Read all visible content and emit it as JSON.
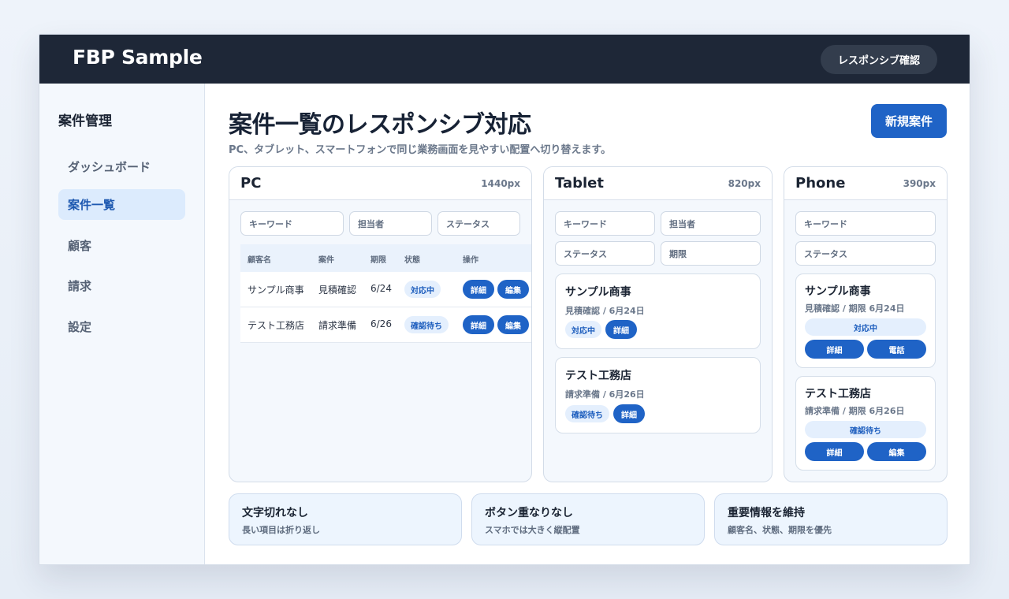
{
  "app": {
    "brand": "FBP Sample",
    "responsive_check_label": "レスポンシブ確認"
  },
  "sidebar": {
    "title": "案件管理",
    "items": [
      {
        "label": "ダッシュボード",
        "active": false
      },
      {
        "label": "案件一覧",
        "active": true
      },
      {
        "label": "顧客",
        "active": false
      },
      {
        "label": "請求",
        "active": false
      },
      {
        "label": "設定",
        "active": false
      }
    ]
  },
  "main": {
    "title": "案件一覧のレスポンシブ対応",
    "subtitle": "PC、タブレット、スマートフォンで同じ業務画面を見やすい配置へ切り替えます。",
    "new_button": "新規案件"
  },
  "pc": {
    "name": "PC",
    "width_label": "1440px",
    "filters": [
      "キーワード",
      "担当者",
      "ステータス"
    ],
    "columns": [
      "顧客名",
      "案件",
      "期限",
      "状態",
      "操作"
    ],
    "rows": [
      {
        "customer": "サンプル商事",
        "project": "見積確認",
        "due": "6/24",
        "status": "対応中",
        "actions": [
          "詳細",
          "編集"
        ]
      },
      {
        "customer": "テスト工務店",
        "project": "請求準備",
        "due": "6/26",
        "status": "確認待ち",
        "actions": [
          "詳細",
          "編集"
        ]
      }
    ]
  },
  "tablet": {
    "name": "Tablet",
    "width_label": "820px",
    "filters": [
      "キーワード",
      "担当者",
      "ステータス",
      "期限"
    ],
    "cards": [
      {
        "title": "サンプル商事",
        "meta": "見積確認 / 6月24日",
        "status": "対応中",
        "action": "詳細"
      },
      {
        "title": "テスト工務店",
        "meta": "請求準備 / 6月26日",
        "status": "確認待ち",
        "action": "詳細"
      }
    ]
  },
  "phone": {
    "name": "Phone",
    "width_label": "390px",
    "filters": [
      "キーワード",
      "ステータス"
    ],
    "cards": [
      {
        "title": "サンプル商事",
        "meta": "見積確認 / 期限 6月24日",
        "status": "対応中",
        "actions": [
          "詳細",
          "電話"
        ]
      },
      {
        "title": "テスト工務店",
        "meta": "請求準備 / 期限 6月26日",
        "status": "確認待ち",
        "actions": [
          "詳細",
          "編集"
        ]
      }
    ]
  },
  "features": [
    {
      "title": "文字切れなし",
      "desc": "長い項目は折り返し"
    },
    {
      "title": "ボタン重なりなし",
      "desc": "スマホでは大きく縦配置"
    },
    {
      "title": "重要情報を維持",
      "desc": "顧客名、状態、期限を優先"
    }
  ]
}
